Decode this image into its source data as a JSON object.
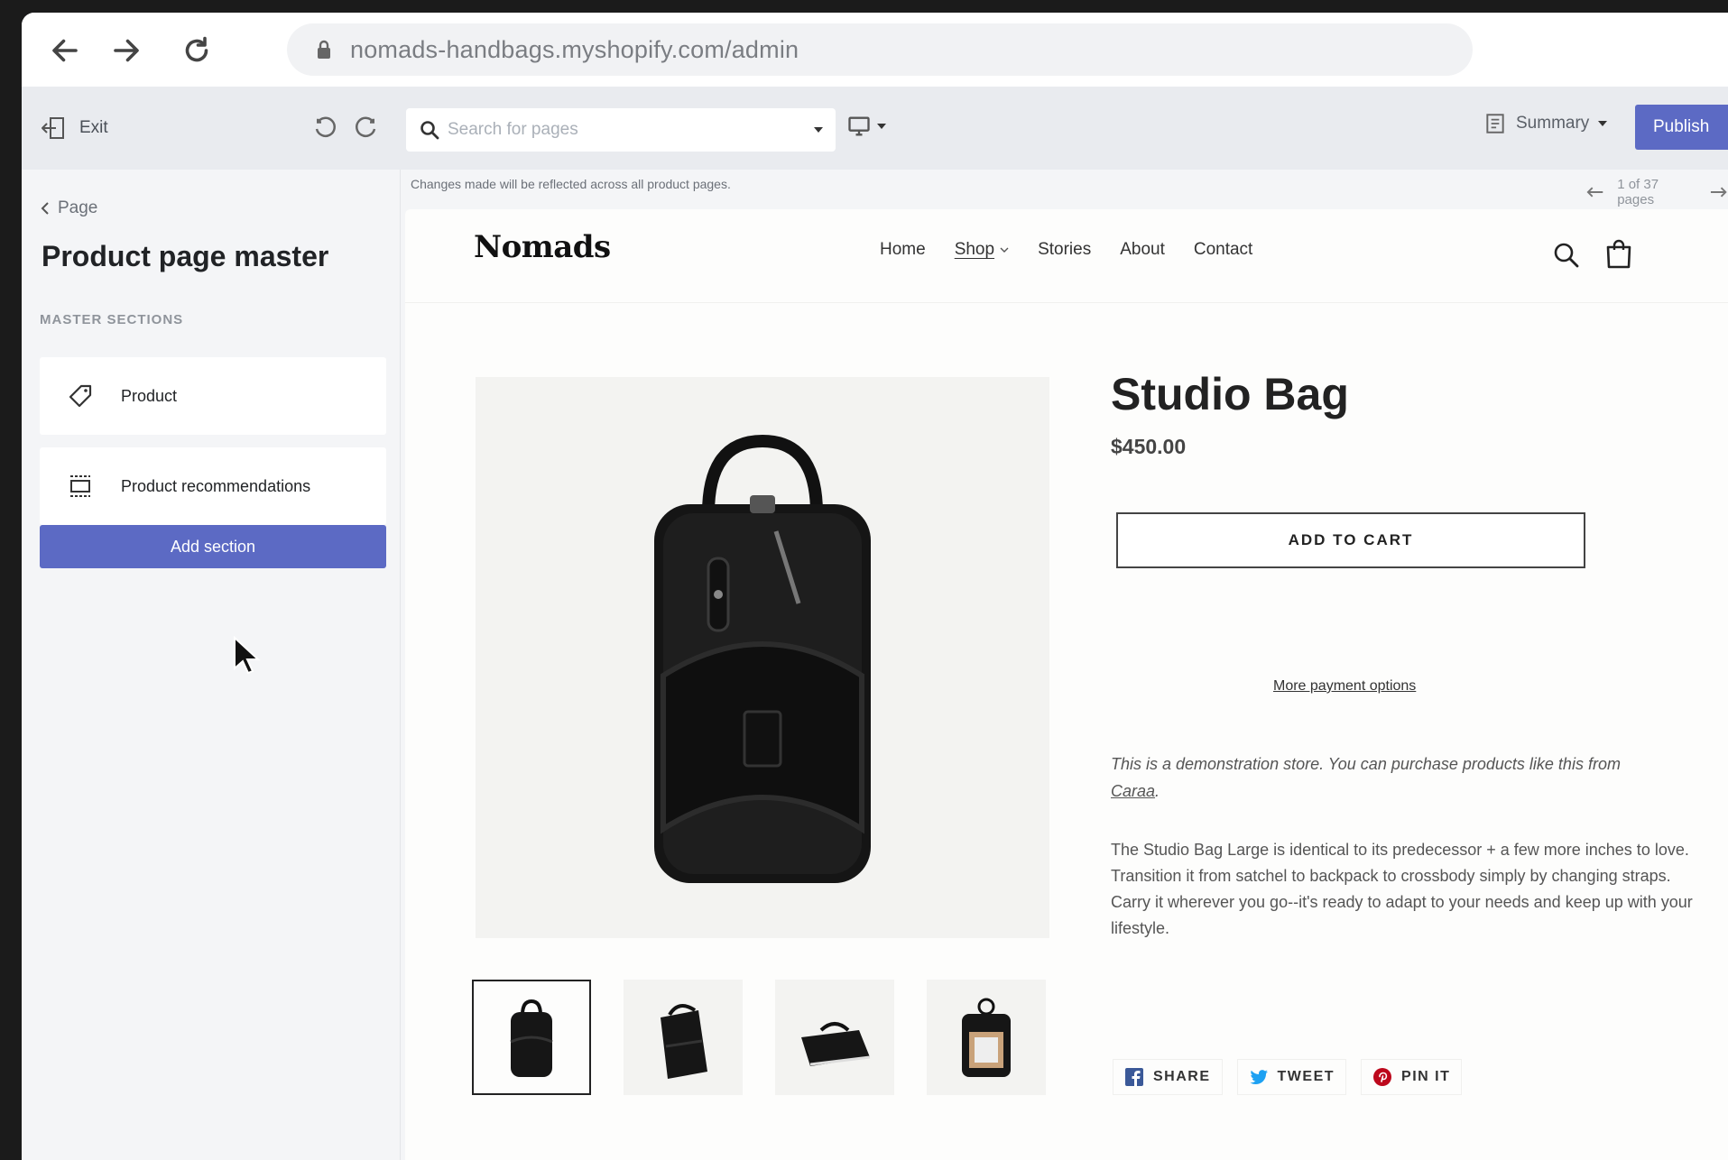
{
  "browser": {
    "url": "nomads-handbags.myshopify.com/admin"
  },
  "toolbar": {
    "exit_label": "Exit",
    "search_placeholder": "Search for pages",
    "summary_label": "Summary",
    "publish_label": "Publish"
  },
  "sidebar": {
    "back_label": "Page",
    "title": "Product page master",
    "sections_heading": "MASTER SECTIONS",
    "sections": [
      {
        "label": "Product",
        "icon": "tag-icon"
      },
      {
        "label": "Product recommendations",
        "icon": "recommendations-icon"
      }
    ],
    "add_section_label": "Add section"
  },
  "preview": {
    "notice": "Changes made will be reflected across all product pages.",
    "pager": "1 of 37 pages"
  },
  "store": {
    "logo": "Nomads",
    "nav": [
      "Home",
      "Shop",
      "Stories",
      "About",
      "Contact"
    ],
    "product": {
      "title": "Studio Bag",
      "price": "$450.00",
      "add_to_cart": "ADD TO CART",
      "more_payment": "More payment options",
      "demo_prefix": "This is a demonstration store. You can purchase products like this from ",
      "demo_link": "Caraa",
      "demo_suffix": ".",
      "description": "The Studio Bag Large is identical to its predecessor + a few more inches to love. Transition it from satchel to backpack to crossbody simply by changing straps. Carry it wherever you go--it's ready to adapt to your needs and keep up with your lifestyle."
    },
    "share": {
      "facebook": "SHARE",
      "twitter": "TWEET",
      "pinterest": "PIN IT"
    }
  },
  "colors": {
    "accent": "#5c6ac4",
    "facebook": "#3b5998",
    "twitter": "#1da1f2",
    "pinterest": "#bd081c"
  }
}
